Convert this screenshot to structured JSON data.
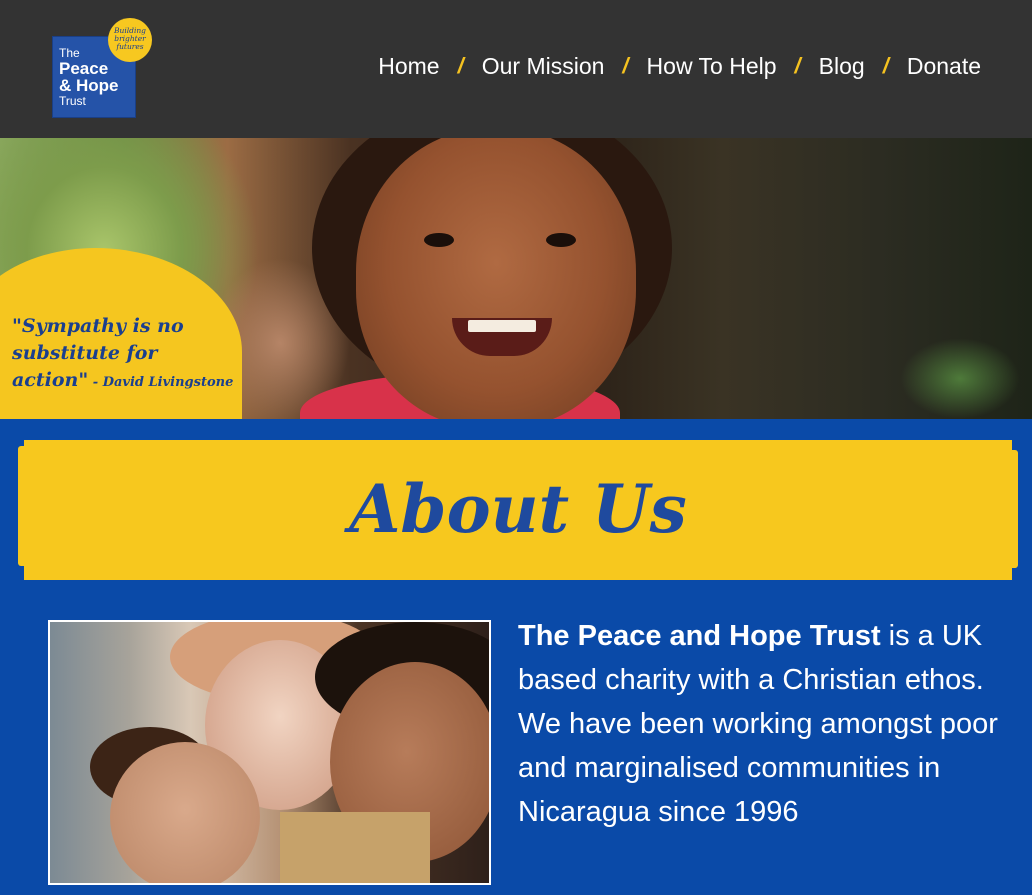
{
  "header": {
    "logo": {
      "line1": "The",
      "line2": "Peace",
      "line3": "& Hope",
      "line4": "Trust",
      "badge": "Building brighter futures"
    },
    "nav": {
      "items": [
        {
          "label": "Home"
        },
        {
          "label": "Our Mission"
        },
        {
          "label": "How To Help"
        },
        {
          "label": "Blog"
        },
        {
          "label": "Donate"
        }
      ],
      "separator": "/"
    }
  },
  "hero": {
    "quote": "\"Sympathy is no substitute for action\"",
    "quote_line1": "\"Sympathy is no",
    "quote_line2": "substitute for",
    "quote_line3": "action\"",
    "attribution": " - David Livingstone"
  },
  "about": {
    "title": "About Us",
    "org_name": "The Peace and Hope Trust",
    "description": " is a UK based charity with a Christian ethos. We have been working amongst poor and marginalised communities in Nicaragua since 1996"
  },
  "colors": {
    "header_bg": "#333333",
    "page_bg": "#0a4aa8",
    "accent_yellow": "#f7c81e",
    "nav_separator": "#f5c220",
    "title_blue": "#1f4a9e"
  }
}
